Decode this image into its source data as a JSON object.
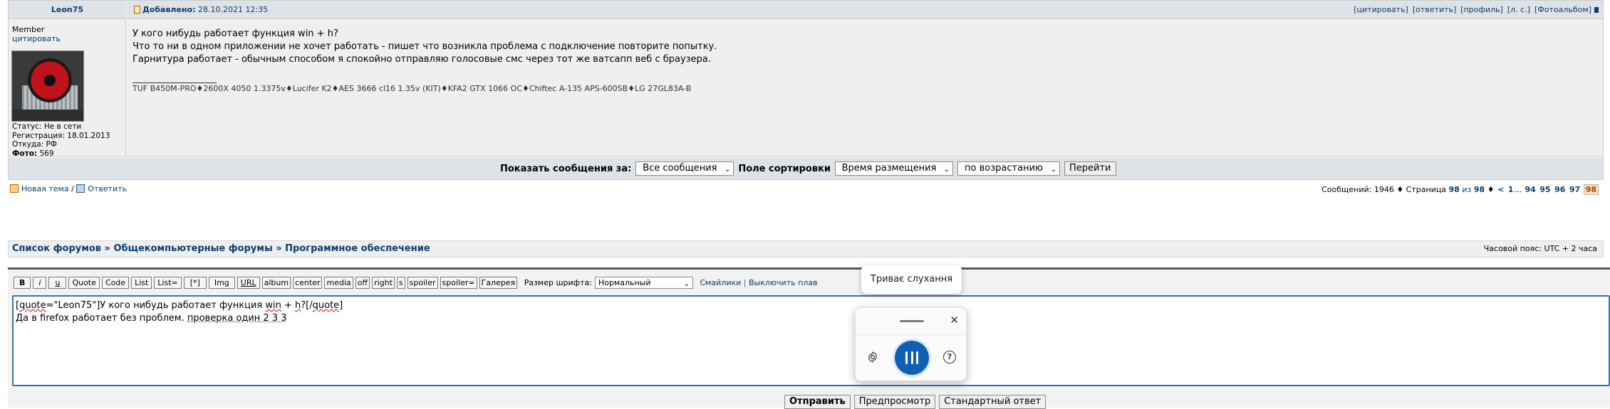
{
  "post": {
    "author": "Leon75",
    "rank": "Member",
    "quote_link": "цитировать",
    "posted_label": "Добавлено:",
    "posted_date": "28.10.2021 12:35",
    "actions": [
      "[цитировать]",
      "[ответить]",
      "[профиль]",
      "[л. с.]",
      "[Фотоальбом]"
    ],
    "stats": {
      "status": "Статус: Не в сети",
      "registered": "Регистрация: 18.01.2013",
      "from": "Откуда: РФ",
      "photo_label": "Фото:",
      "photo_count": "569"
    },
    "body_lines": [
      "У кого нибудь работает функция win + h?",
      "Что то ни в одном приложении не хочет работать - пишет что возникла проблема с подключение повторите попытку.",
      "Гарнитура работает - обычным способом я спокойно отправляю голосовые смс через тот же ватсапп веб с браузера."
    ],
    "signature": "TUF B450M-PRO♦2600X 4050 1.3375v♦Lucifer K2♦AES 3666 cl16 1.35v (KIT)♦KFA2 GTX 1066 OC♦Chiftec A-135 APS-600SB♦LG 27GL83A-B"
  },
  "display_options": {
    "show_label": "Показать сообщения за:",
    "show_value": "Все сообщения",
    "sort_label": "Поле сортировки",
    "sort_field": "Время размещения",
    "sort_order": "по возрастанию",
    "go_button": "Перейти"
  },
  "tools": {
    "new_topic": "Новая тема",
    "separator": "/",
    "reply": "Ответить"
  },
  "pagination": {
    "summary": "Сообщений: 1946 ♦ Страница",
    "current": "98",
    "of": "из",
    "total": "98",
    "sep": "♦",
    "prev": "<",
    "pages": [
      "1",
      "...",
      "94",
      "95",
      "96",
      "97"
    ],
    "active": "98"
  },
  "breadcrumb": {
    "text": "Список форумов » Общекомпьютерные форумы » Программное обеспечение",
    "timezone": "Часовой пояс: UTC + 2 часа"
  },
  "editor": {
    "buttons": [
      "B",
      "i",
      "u",
      "Quote",
      "Code",
      "List",
      "List=",
      "[*]",
      "Img",
      "URL",
      "album",
      "center",
      "media",
      "off",
      "right",
      "s",
      "spoiler",
      "spoiler=",
      "Галерея"
    ],
    "font_size_label": "Размер шрифта:",
    "font_size_value": "Нормальный",
    "smilies_link": "Смайлики",
    "link_sep": "|",
    "disable_link": "Выключить плав",
    "text_line1_a": "[",
    "text_line1_quote": "quote",
    "text_line1_b": "=\"Leon75\"]У кого нибудь работает функция ",
    "text_line1_win": "win",
    "text_line1_c": " + ",
    "text_line1_h": "h",
    "text_line1_d": "?[/",
    "text_line1_endquote": "quote",
    "text_line1_e": "]",
    "text_line2_a": "Да в firefox работает без проблем. ",
    "text_line2_b": "проверка один 2 3 3",
    "submit": "Отправить",
    "preview": "Предпросмотр",
    "standard": "Стандартный ответ"
  },
  "voice": {
    "tooltip": "Триває слухання",
    "close": "✕",
    "help": "?"
  }
}
